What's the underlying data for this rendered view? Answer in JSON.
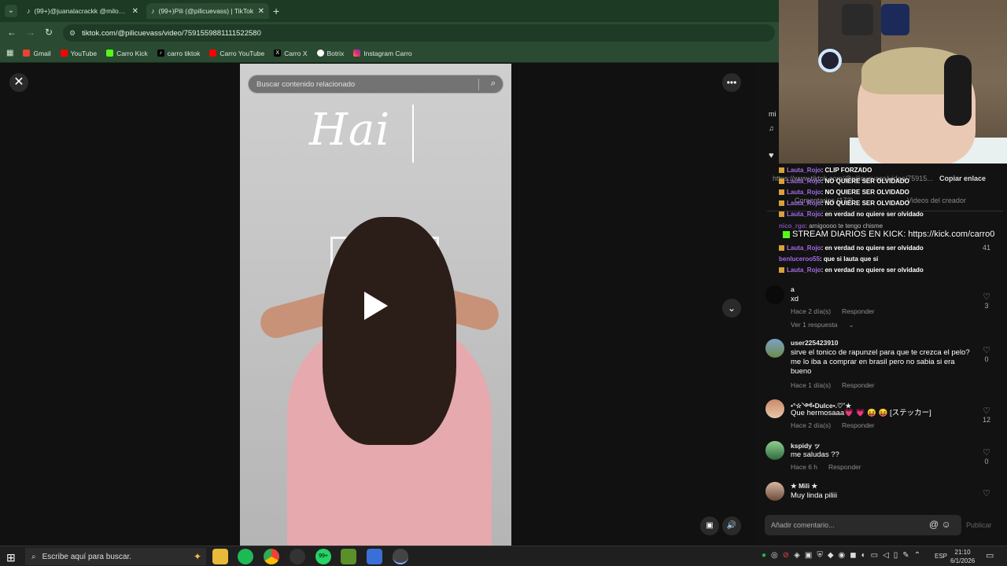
{
  "browser": {
    "tabs": [
      {
        "label": "(99+)@juanalacrackk @milozes",
        "close": "✕",
        "active": false
      },
      {
        "label": "(99+)Pili (@pilicuevass) | TikTok",
        "close": "✕",
        "active": true
      }
    ],
    "new_tab": "+",
    "url": "tiktok.com/@pilicuevass/video/7591559881111522580",
    "bookmarks": [
      "Gmail",
      "YouTube",
      "Carro Kick",
      "carro tiktok",
      "Carro YouTube",
      "Carro X",
      "Botrix",
      "Instagram Carro"
    ]
  },
  "video": {
    "search_placeholder": "Buscar contenido relacionado",
    "overlay_text": "Hai"
  },
  "panel": {
    "copy_link": "Copiar enlace",
    "creator_videos": "Videos del creador",
    "ghost_url": "https://www.tiktok.com/@pilicuevass/video/75915...",
    "ghost_comments_tab": "Comentarios (173)",
    "count_41": "41",
    "name_stub": "mi",
    "note_icon": "♫"
  },
  "stream_chat": [
    {
      "user": "Lauta_Rojo",
      "text": ": CLIP FORZADO"
    },
    {
      "user": "Lauta_Rojo",
      "text": ": NO QUIERE SER OLVIDADO"
    },
    {
      "user": "Lauta_Rojo",
      "text": ": NO QUIERE SER OLVIDADO"
    },
    {
      "user": "Lauta_Rojo",
      "text": ": NO QUIERE SER OLVIDADO"
    },
    {
      "user": "Lauta_Rojo",
      "text": ": en verdad no quiere ser olvidado"
    },
    {
      "user": "nico_rgo",
      "text": ": amigoooo te tengo chisme"
    },
    {
      "user": "Lauta_Rojo",
      "text": ": en verdad no quiere ser olvidado"
    },
    {
      "user": "benluceroo55",
      "text": ": que si lauta que si"
    },
    {
      "user": "Lauta_Rojo",
      "text": ": en verdad no quiere ser olvidado"
    }
  ],
  "stream_banner": "STREAM DIARIOS EN KICK: https://kick.com/carro0",
  "comments": [
    {
      "name": "a",
      "text": "xd",
      "time": "Hace 2 día(s)",
      "reply": "Responder",
      "likes": "3",
      "replies": "Ver 1 respuesta"
    },
    {
      "name": "user225423910",
      "text": "sirve el tonico de rapunzel para que te crezca el pelo? me lo iba a comprar en brasil pero no sabia si era bueno",
      "time": "Hace 1 día(s)",
      "reply": "Responder",
      "likes": "0"
    },
    {
      "name": "•°☆༺•Dulce•.♡˚★",
      "text": "Que hermosaaa💗 💗 😝 😝 [ステッカー]",
      "time": "Hace 2 día(s)",
      "reply": "Responder",
      "likes": "12"
    },
    {
      "name": "kspidy ッ",
      "text": "me saludas ??",
      "time": "Hace 6 h",
      "reply": "Responder",
      "likes": "0"
    },
    {
      "name": "★ Mili ★",
      "text": "Muy linda piliii",
      "time": "",
      "reply": "",
      "likes": ""
    }
  ],
  "comment_input": {
    "placeholder": "Añadir comentario...",
    "publish": "Publicar",
    "mention": "@",
    "emoji": "☺"
  },
  "taskbar": {
    "search_placeholder": "Escribe aquí para buscar.",
    "lang": "ESP",
    "time": "21:10",
    "date": "6/1/2026",
    "whatsapp_badge": "99+"
  }
}
